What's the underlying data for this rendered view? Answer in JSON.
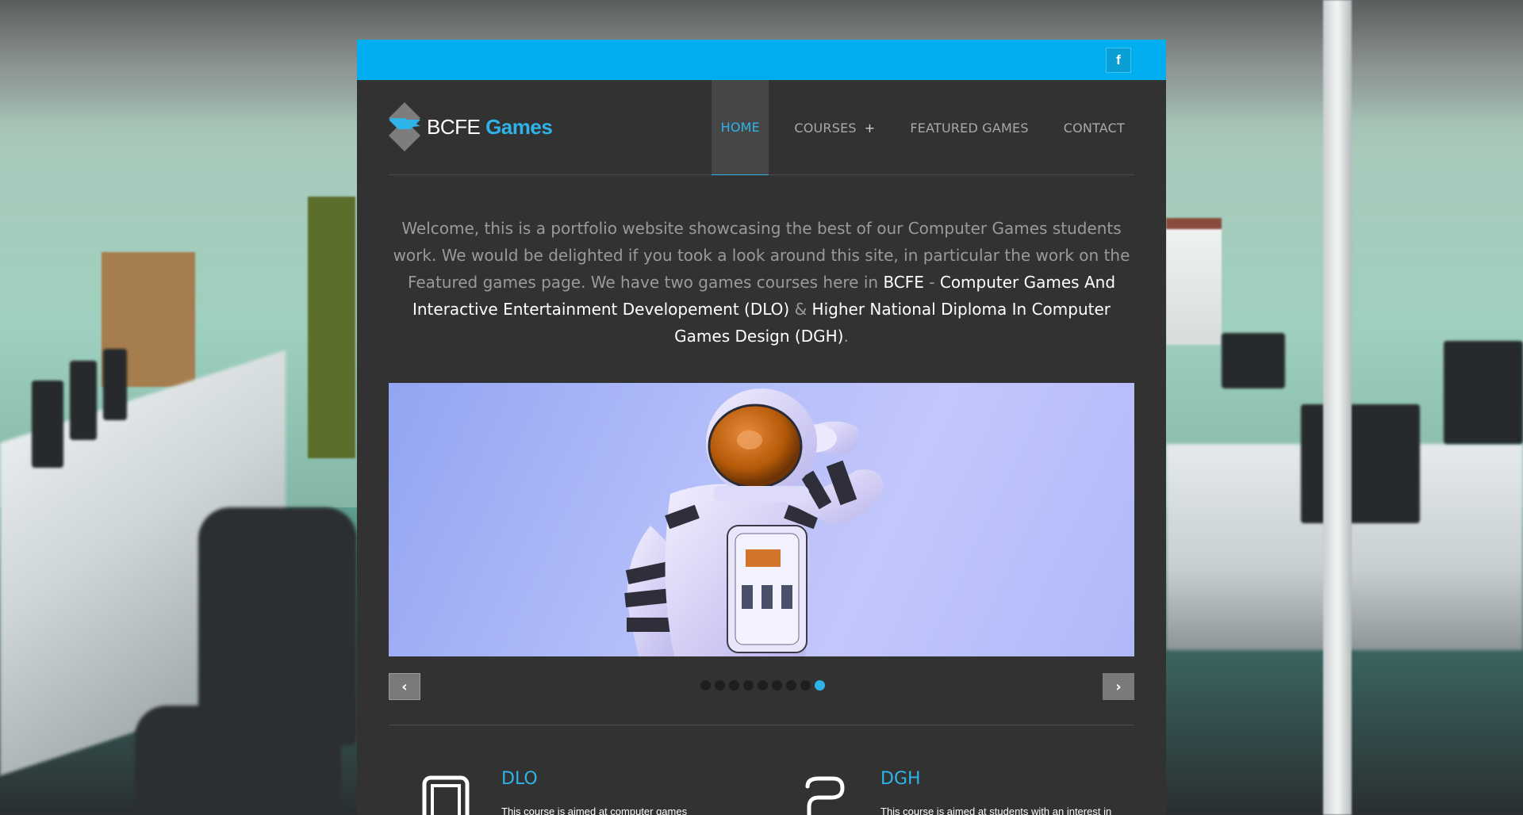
{
  "topbar": {
    "facebook_label": "f"
  },
  "logo": {
    "text_plain": "BCFE",
    "text_accent": "Games"
  },
  "nav": {
    "items": [
      {
        "label": "HOME"
      },
      {
        "label": "COURSES",
        "submenu_marker": "+"
      },
      {
        "label": "FEATURED GAMES"
      },
      {
        "label": "CONTACT"
      }
    ]
  },
  "welcome": {
    "intro": "Welcome, this is a portfolio website showcasing the best of our Computer Games students work. We would be delighted if you took a look around this site, in particular the work on the Featured games page. We have two games courses here in ",
    "bcfe": "BCFE",
    "dash": " - ",
    "course1": "Computer Games And Interactive Entertainment Developement (DLO)",
    "amp": " & ",
    "course2": "Higher National Diploma In Computer Games Design (DGH)",
    "end": "."
  },
  "slider": {
    "prev_label": "‹",
    "next_label": "›",
    "dot_count": 9,
    "active_dot": 9
  },
  "courses": [
    {
      "title": "DLO",
      "text": "This course is aimed at computer games",
      "icon": "tablet-icon"
    },
    {
      "title": "DGH",
      "text": "This course is aimed at students with an interest in",
      "icon": "controller-icon"
    }
  ],
  "colors": {
    "accent": "#00aeef",
    "panel": "#323232",
    "link": "#2fb4ea"
  }
}
